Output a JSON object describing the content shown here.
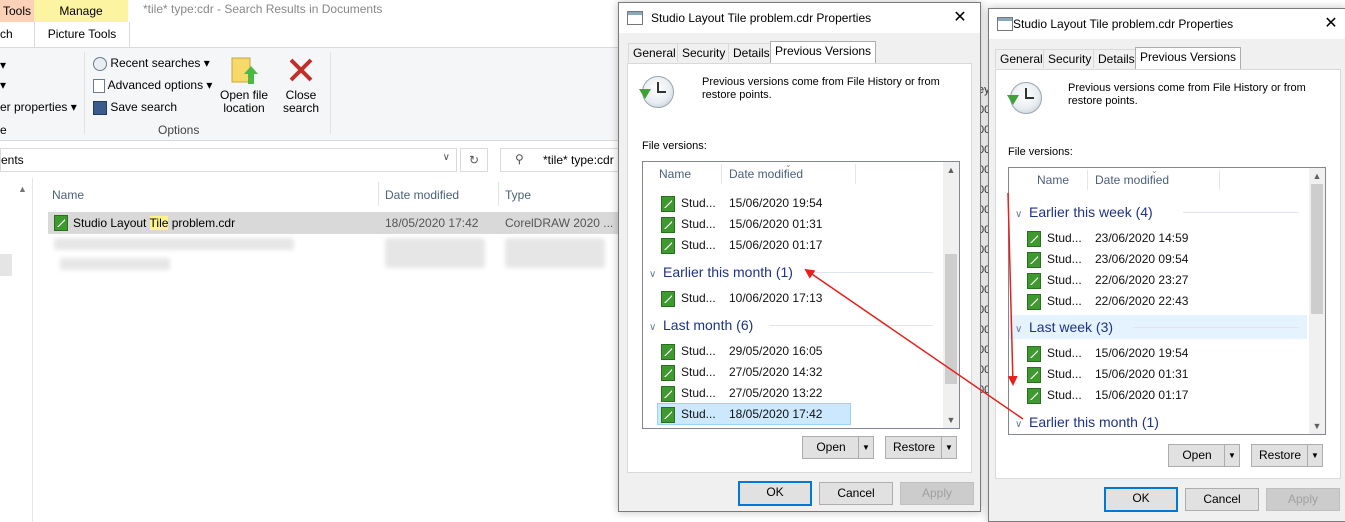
{
  "explorer": {
    "context_tabs": {
      "left": "Tools",
      "manage": "Manage",
      "picture_tools": "Picture Tools"
    },
    "partial_tab": "ch",
    "window_title": "*tile* type:cdr - Search Results in Documents",
    "commands": {
      "recent_searches": "Recent searches",
      "advanced_options": "Advanced options",
      "save_search": "Save search",
      "open_file_location": [
        "Open file",
        "location"
      ],
      "close_search": [
        "Close",
        "search"
      ],
      "other_properties": "er properties",
      "options_group": "Options",
      "partial_e": "e"
    },
    "address": "ents",
    "search_box": "*tile* type:cdr",
    "columns": {
      "name": "Name",
      "date_modified": "Date modified",
      "type": "Type"
    },
    "file": {
      "name_before": "Studio Layout ",
      "name_highlight": "Tile",
      "name_after": " problem.cdr",
      "date": "18/05/2020 17:42",
      "type": "CorelDRAW 2020 ..."
    }
  },
  "dialog1": {
    "title": "Studio Layout Tile problem.cdr Properties",
    "tabs": [
      "General",
      "Security",
      "Details",
      "Previous Versions"
    ],
    "info": [
      "Previous versions come from File History or from",
      "restore points."
    ],
    "file_versions_label": "File versions:",
    "headers": {
      "name": "Name",
      "date_modified": "Date modified"
    },
    "top_rows": [
      {
        "name": "Stud...",
        "date": "15/06/2020 19:54"
      },
      {
        "name": "Stud...",
        "date": "15/06/2020 01:31"
      },
      {
        "name": "Stud...",
        "date": "15/06/2020 01:17"
      }
    ],
    "group1": "Earlier this month (1)",
    "group1_rows": [
      {
        "name": "Stud...",
        "date": "10/06/2020 17:13"
      }
    ],
    "group2": "Last month (6)",
    "group2_rows": [
      {
        "name": "Stud...",
        "date": "29/05/2020 16:05"
      },
      {
        "name": "Stud...",
        "date": "27/05/2020 14:32"
      },
      {
        "name": "Stud...",
        "date": "27/05/2020 13:22"
      },
      {
        "name": "Stud...",
        "date": "18/05/2020 17:42"
      }
    ],
    "buttons": {
      "open": "Open",
      "restore": "Restore",
      "ok": "OK",
      "cancel": "Cancel",
      "apply": "Apply"
    }
  },
  "dialog2": {
    "title": "Studio Layout Tile problem.cdr Properties",
    "tabs": [
      "General",
      "Security",
      "Details",
      "Previous Versions"
    ],
    "info": [
      "Previous versions come from File History or from",
      "restore points."
    ],
    "file_versions_label": "File versions:",
    "headers": {
      "name": "Name",
      "date_modified": "Date modified"
    },
    "group1": "Earlier this week (4)",
    "group1_rows": [
      {
        "name": "Stud...",
        "date": "23/06/2020 14:59"
      },
      {
        "name": "Stud...",
        "date": "23/06/2020 09:54"
      },
      {
        "name": "Stud...",
        "date": "22/06/2020 23:27"
      },
      {
        "name": "Stud...",
        "date": "22/06/2020 22:43"
      }
    ],
    "group2": "Last week (3)",
    "group2_rows": [
      {
        "name": "Stud...",
        "date": "15/06/2020 19:54"
      },
      {
        "name": "Stud...",
        "date": "15/06/2020 01:31"
      },
      {
        "name": "Stud...",
        "date": "15/06/2020 01:17"
      }
    ],
    "group3": "Earlier this month (1)",
    "buttons": {
      "open": "Open",
      "restore": "Restore",
      "ok": "OK",
      "cancel": "Cancel",
      "apply": "Apply"
    }
  },
  "annotation_color": "#e8201c",
  "icons": [
    "clock-restore-icon",
    "coreldraw-file-icon",
    "close-icon",
    "refresh-icon",
    "search-icon",
    "open-location-icon",
    "close-search-icon"
  ]
}
